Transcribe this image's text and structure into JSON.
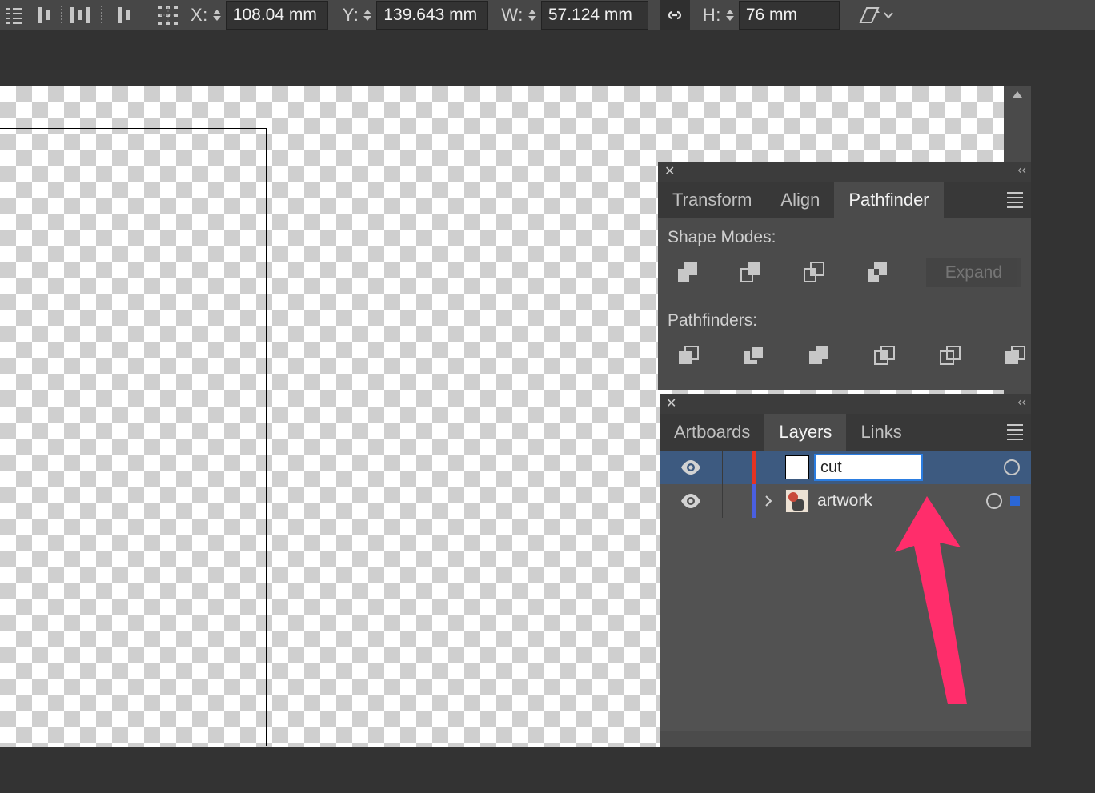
{
  "toolbar": {
    "x_label": "X:",
    "y_label": "Y:",
    "w_label": "W:",
    "h_label": "H:",
    "x_value": "108.04 mm",
    "y_value": "139.643 mm",
    "w_value": "57.124 mm",
    "h_value": "76 mm"
  },
  "pathfinder_panel": {
    "tabs": [
      "Transform",
      "Align",
      "Pathfinder"
    ],
    "active_tab": "Pathfinder",
    "shape_modes_label": "Shape Modes:",
    "expand_label": "Expand",
    "pathfinders_label": "Pathfinders:"
  },
  "layers_panel": {
    "tabs": [
      "Artboards",
      "Layers",
      "Links"
    ],
    "active_tab": "Layers",
    "layers": [
      {
        "name": "cut",
        "color": "#e53322",
        "editing": true,
        "selected": true,
        "has_sel_square": false,
        "expandable": false
      },
      {
        "name": "artwork",
        "color": "#4a5fe0",
        "editing": false,
        "selected": false,
        "has_sel_square": true,
        "expandable": true
      }
    ]
  }
}
